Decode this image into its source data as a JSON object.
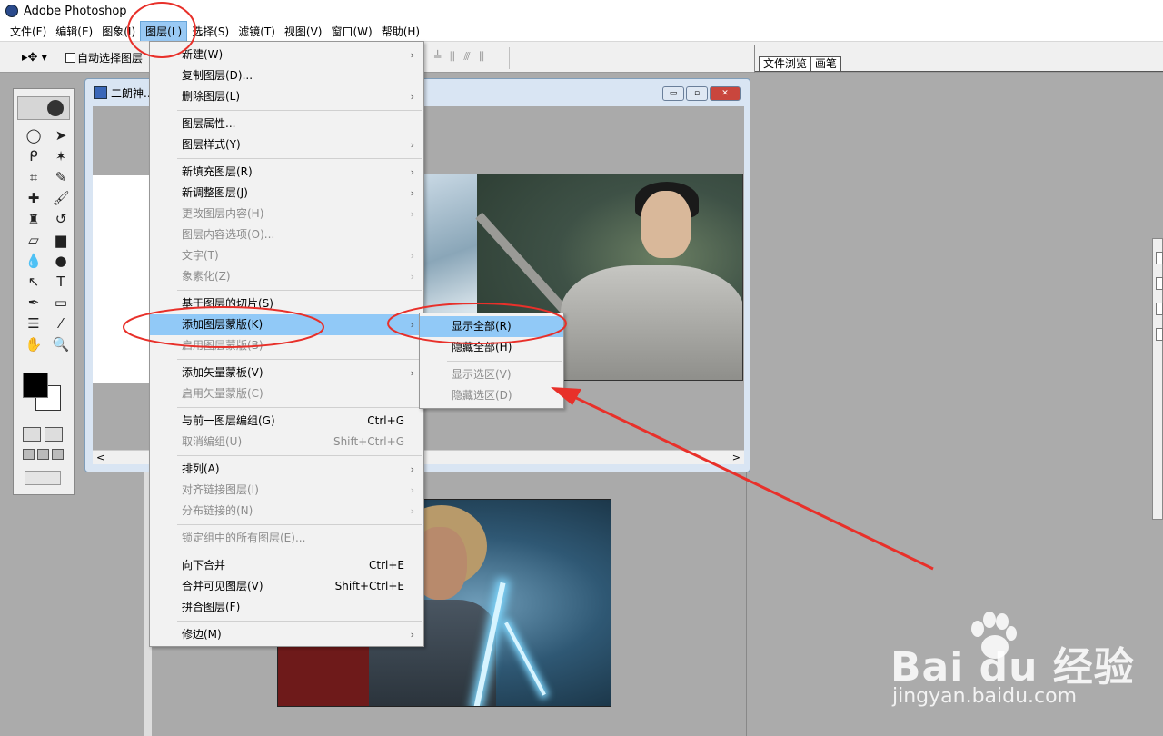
{
  "app": {
    "title": "Adobe Photoshop"
  },
  "menubar": [
    {
      "label": "文件(F)"
    },
    {
      "label": "编辑(E)"
    },
    {
      "label": "图象(I)"
    },
    {
      "label": "图层(L)",
      "active": true
    },
    {
      "label": "选择(S)"
    },
    {
      "label": "滤镜(T)"
    },
    {
      "label": "视图(V)"
    },
    {
      "label": "窗口(W)"
    },
    {
      "label": "帮助(H)"
    }
  ],
  "options_bar": {
    "tool_glyph": "▸✥ ▾",
    "autoselect_label": "自动选择图层",
    "align_glyphs": "╧ ⫼ ⫻ ⫼",
    "palette_tabs": [
      "文件浏览",
      "画笔"
    ]
  },
  "document": {
    "title": "二朗神...",
    "scroll_left": "<",
    "scroll_right": ">",
    "min_glyph": "▭",
    "max_glyph": "▫",
    "close_glyph": "✕"
  },
  "layer_menu": {
    "items": [
      {
        "label": "新建(W)",
        "submenu": true
      },
      {
        "label": "复制图层(D)..."
      },
      {
        "label": "删除图层(L)",
        "submenu": true
      },
      {
        "separator": true
      },
      {
        "label": "图层属性..."
      },
      {
        "label": "图层样式(Y)",
        "submenu": true
      },
      {
        "separator": true
      },
      {
        "label": "新填充图层(R)",
        "submenu": true
      },
      {
        "label": "新调整图层(J)",
        "submenu": true
      },
      {
        "label": "更改图层内容(H)",
        "submenu": true,
        "disabled": true
      },
      {
        "label": "图层内容选项(O)...",
        "disabled": true
      },
      {
        "label": "文字(T)",
        "submenu": true,
        "disabled": true
      },
      {
        "label": "象素化(Z)",
        "submenu": true,
        "disabled": true
      },
      {
        "separator": true
      },
      {
        "label": "基于图层的切片(S)"
      },
      {
        "label": "添加图层蒙版(K)",
        "submenu": true,
        "highlighted": true
      },
      {
        "label": "启用图层蒙版(B)",
        "disabled": true
      },
      {
        "separator": true
      },
      {
        "label": "添加矢量蒙板(V)",
        "submenu": true
      },
      {
        "label": "启用矢量蒙版(C)",
        "disabled": true
      },
      {
        "separator": true
      },
      {
        "label": "与前一图层编组(G)",
        "shortcut": "Ctrl+G"
      },
      {
        "label": "取消编组(U)",
        "shortcut": "Shift+Ctrl+G",
        "disabled": true
      },
      {
        "separator": true
      },
      {
        "label": "排列(A)",
        "submenu": true
      },
      {
        "label": "对齐链接图层(I)",
        "submenu": true,
        "disabled": true
      },
      {
        "label": "分布链接的(N)",
        "submenu": true,
        "disabled": true
      },
      {
        "separator": true
      },
      {
        "label": "锁定组中的所有图层(E)...",
        "disabled": true
      },
      {
        "separator": true
      },
      {
        "label": "向下合并",
        "shortcut": "Ctrl+E"
      },
      {
        "label": "合并可见图层(V)",
        "shortcut": "Shift+Ctrl+E"
      },
      {
        "label": "拼合图层(F)"
      },
      {
        "separator": true
      },
      {
        "label": "修边(M)",
        "submenu": true
      }
    ]
  },
  "mask_submenu": {
    "items": [
      {
        "label": "显示全部(R)",
        "highlighted": true
      },
      {
        "label": "隐藏全部(H)"
      },
      {
        "separator": true
      },
      {
        "label": "显示选区(V)",
        "disabled": true
      },
      {
        "label": "隐藏选区(D)",
        "disabled": true
      }
    ]
  },
  "submenu_arrow": "›",
  "watermark": {
    "brand": "Bai du 经验",
    "url": "jingyan.baidu.com"
  },
  "colors": {
    "highlight": "#91c9f7",
    "annotation": "#e8302a"
  }
}
